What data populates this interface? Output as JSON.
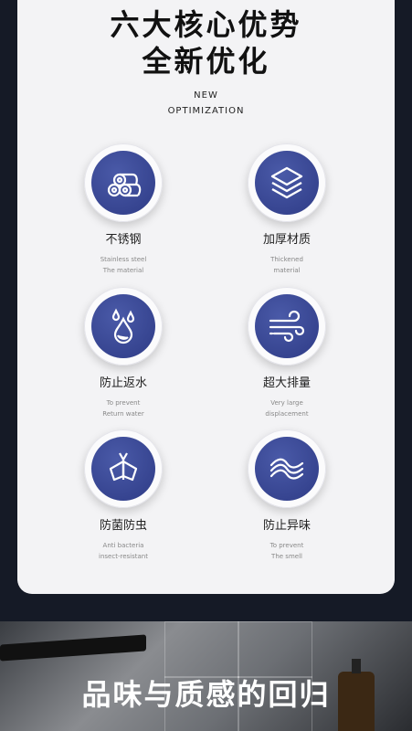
{
  "header": {
    "title_line1": "六大核心优势",
    "title_line2": "全新优化",
    "sub_line1": "NEW",
    "sub_line2": "OPTIMIZATION"
  },
  "features": [
    {
      "name": "不锈钢",
      "en1": "Stainless steel",
      "en2": "The material",
      "icon": "pipes-icon"
    },
    {
      "name": "加厚材质",
      "en1": "Thickened",
      "en2": "material",
      "icon": "layers-icon"
    },
    {
      "name": "防止返水",
      "en1": "To prevent",
      "en2": "Return water",
      "icon": "water-drop-icon"
    },
    {
      "name": "超大排量",
      "en1": "Very large",
      "en2": "displacement",
      "icon": "wind-icon"
    },
    {
      "name": "防菌防虫",
      "en1": "Anti bacteria",
      "en2": "insect-resistant",
      "icon": "moth-icon"
    },
    {
      "name": "防止异味",
      "en1": "To prevent",
      "en2": "The smell",
      "icon": "waves-icon"
    }
  ],
  "banner": {
    "slogan": "品味与质感的回归"
  },
  "colors": {
    "icon_disc": "#34428e",
    "card": "#f3f3f5",
    "background": "#151a26"
  }
}
